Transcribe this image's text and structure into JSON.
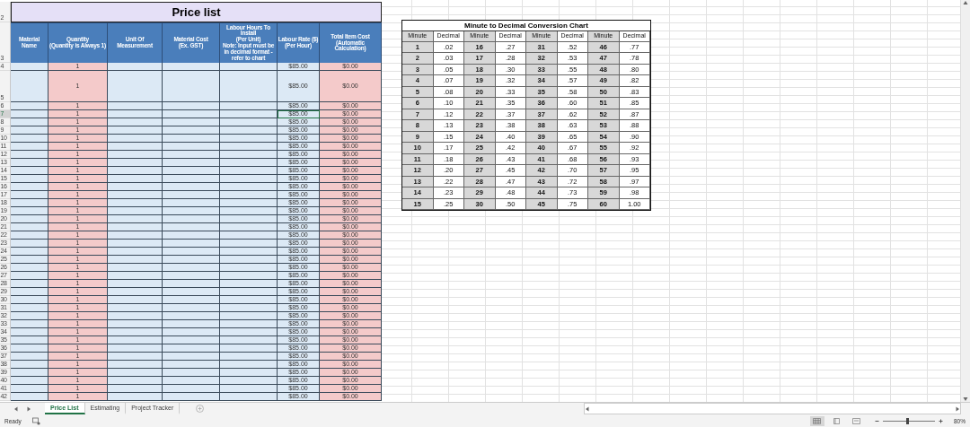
{
  "price_list": {
    "row_number": "2",
    "title": "Price list",
    "header_row_number": "3",
    "columns": [
      {
        "label": "Material Name"
      },
      {
        "label": "Quantity",
        "sub": "(Quantity is Always 1)"
      },
      {
        "label": "Unit Of Measurement"
      },
      {
        "label": "Material Cost",
        "sub": "(Ex. GST)"
      },
      {
        "label": "Labour Hours To Install",
        "sub": "(Per Unit)",
        "note": "Note: Input must be in decimal format - refer to chart"
      },
      {
        "label": "Labour Rate ($)",
        "sub": "(Per Hour)"
      },
      {
        "label": "Total Item Cost",
        "sub": "(Automatic Calculation)"
      }
    ],
    "rows": [
      {
        "number": "4",
        "kind": "normal",
        "quantity": "1",
        "labour_rate": "$85.00",
        "total": "$0.00",
        "selected": false
      },
      {
        "number": "5",
        "kind": "tall",
        "quantity": "1",
        "labour_rate": "$85.00",
        "total": "$0.00",
        "selected": false
      },
      {
        "number": "6",
        "kind": "normal",
        "quantity": "1",
        "labour_rate": "$85.00",
        "total": "$0.00",
        "selected": false
      },
      {
        "number": "7",
        "kind": "normal",
        "quantity": "1",
        "labour_rate": "$85.00",
        "total": "$0.00",
        "selected": true
      },
      {
        "number": "8",
        "kind": "normal",
        "quantity": "1",
        "labour_rate": "$85.00",
        "total": "$0.00",
        "selected": false
      },
      {
        "number": "9",
        "kind": "normal",
        "quantity": "1",
        "labour_rate": "$85.00",
        "total": "$0.00",
        "selected": false
      },
      {
        "number": "10",
        "kind": "normal",
        "quantity": "1",
        "labour_rate": "$85.00",
        "total": "$0.00",
        "selected": false
      },
      {
        "number": "11",
        "kind": "normal",
        "quantity": "1",
        "labour_rate": "$85.00",
        "total": "$0.00",
        "selected": false
      },
      {
        "number": "12",
        "kind": "normal",
        "quantity": "1",
        "labour_rate": "$85.00",
        "total": "$0.00",
        "selected": false
      },
      {
        "number": "13",
        "kind": "normal",
        "quantity": "1",
        "labour_rate": "$85.00",
        "total": "$0.00",
        "selected": false
      },
      {
        "number": "14",
        "kind": "normal",
        "quantity": "1",
        "labour_rate": "$85.00",
        "total": "$0.00",
        "selected": false
      },
      {
        "number": "15",
        "kind": "normal",
        "quantity": "1",
        "labour_rate": "$85.00",
        "total": "$0.00",
        "selected": false
      },
      {
        "number": "16",
        "kind": "normal",
        "quantity": "1",
        "labour_rate": "$85.00",
        "total": "$0.00",
        "selected": false
      },
      {
        "number": "17",
        "kind": "normal",
        "quantity": "1",
        "labour_rate": "$85.00",
        "total": "$0.00",
        "selected": false
      },
      {
        "number": "18",
        "kind": "normal",
        "quantity": "1",
        "labour_rate": "$85.00",
        "total": "$0.00",
        "selected": false
      },
      {
        "number": "19",
        "kind": "normal",
        "quantity": "1",
        "labour_rate": "$85.00",
        "total": "$0.00",
        "selected": false
      },
      {
        "number": "20",
        "kind": "normal",
        "quantity": "1",
        "labour_rate": "$85.00",
        "total": "$0.00",
        "selected": false
      },
      {
        "number": "21",
        "kind": "normal",
        "quantity": "1",
        "labour_rate": "$85.00",
        "total": "$0.00",
        "selected": false
      },
      {
        "number": "22",
        "kind": "normal",
        "quantity": "1",
        "labour_rate": "$85.00",
        "total": "$0.00",
        "selected": false
      },
      {
        "number": "23",
        "kind": "normal",
        "quantity": "1",
        "labour_rate": "$85.00",
        "total": "$0.00",
        "selected": false
      },
      {
        "number": "24",
        "kind": "normal",
        "quantity": "1",
        "labour_rate": "$85.00",
        "total": "$0.00",
        "selected": false
      },
      {
        "number": "25",
        "kind": "normal",
        "quantity": "1",
        "labour_rate": "$85.00",
        "total": "$0.00",
        "selected": false
      },
      {
        "number": "26",
        "kind": "normal",
        "quantity": "1",
        "labour_rate": "$85.00",
        "total": "$0.00",
        "selected": false
      },
      {
        "number": "27",
        "kind": "normal",
        "quantity": "1",
        "labour_rate": "$85.00",
        "total": "$0.00",
        "selected": false
      },
      {
        "number": "28",
        "kind": "normal",
        "quantity": "1",
        "labour_rate": "$85.00",
        "total": "$0.00",
        "selected": false
      },
      {
        "number": "29",
        "kind": "normal",
        "quantity": "1",
        "labour_rate": "$85.00",
        "total": "$0.00",
        "selected": false
      },
      {
        "number": "30",
        "kind": "normal",
        "quantity": "1",
        "labour_rate": "$85.00",
        "total": "$0.00",
        "selected": false
      },
      {
        "number": "31",
        "kind": "normal",
        "quantity": "1",
        "labour_rate": "$85.00",
        "total": "$0.00",
        "selected": false
      },
      {
        "number": "32",
        "kind": "normal",
        "quantity": "1",
        "labour_rate": "$85.00",
        "total": "$0.00",
        "selected": false
      },
      {
        "number": "33",
        "kind": "normal",
        "quantity": "1",
        "labour_rate": "$85.00",
        "total": "$0.00",
        "selected": false
      },
      {
        "number": "34",
        "kind": "normal",
        "quantity": "1",
        "labour_rate": "$85.00",
        "total": "$0.00",
        "selected": false
      },
      {
        "number": "35",
        "kind": "normal",
        "quantity": "1",
        "labour_rate": "$85.00",
        "total": "$0.00",
        "selected": false
      },
      {
        "number": "36",
        "kind": "normal",
        "quantity": "1",
        "labour_rate": "$85.00",
        "total": "$0.00",
        "selected": false
      },
      {
        "number": "37",
        "kind": "normal",
        "quantity": "1",
        "labour_rate": "$85.00",
        "total": "$0.00",
        "selected": false
      },
      {
        "number": "38",
        "kind": "normal",
        "quantity": "1",
        "labour_rate": "$85.00",
        "total": "$0.00",
        "selected": false
      },
      {
        "number": "39",
        "kind": "normal",
        "quantity": "1",
        "labour_rate": "$85.00",
        "total": "$0.00",
        "selected": false
      },
      {
        "number": "40",
        "kind": "normal",
        "quantity": "1",
        "labour_rate": "$85.00",
        "total": "$0.00",
        "selected": false
      },
      {
        "number": "41",
        "kind": "normal",
        "quantity": "1",
        "labour_rate": "$85.00",
        "total": "$0.00",
        "selected": false
      },
      {
        "number": "42",
        "kind": "normal",
        "quantity": "1",
        "labour_rate": "$85.00",
        "total": "$0.00",
        "selected": false
      }
    ]
  },
  "conversion_chart": {
    "title": "Minute to Decimal Conversion Chart",
    "headers": [
      "Minute",
      "Decimal",
      "Minute",
      "Decimal",
      "Minute",
      "Decimal",
      "Minute",
      "Decimal"
    ],
    "rows": [
      [
        "1",
        ".02",
        "16",
        ".27",
        "31",
        ".52",
        "46",
        ".77"
      ],
      [
        "2",
        ".03",
        "17",
        ".28",
        "32",
        ".53",
        "47",
        ".78"
      ],
      [
        "3",
        ".05",
        "18",
        ".30",
        "33",
        ".55",
        "48",
        ".80"
      ],
      [
        "4",
        ".07",
        "19",
        ".32",
        "34",
        ".57",
        "49",
        ".82"
      ],
      [
        "5",
        ".08",
        "20",
        ".33",
        "35",
        ".58",
        "50",
        ".83"
      ],
      [
        "6",
        ".10",
        "21",
        ".35",
        "36",
        ".60",
        "51",
        ".85"
      ],
      [
        "7",
        ".12",
        "22",
        ".37",
        "37",
        ".62",
        "52",
        ".87"
      ],
      [
        "8",
        ".13",
        "23",
        ".38",
        "38",
        ".63",
        "53",
        ".88"
      ],
      [
        "9",
        ".15",
        "24",
        ".40",
        "39",
        ".65",
        "54",
        ".90"
      ],
      [
        "10",
        ".17",
        "25",
        ".42",
        "40",
        ".67",
        "55",
        ".92"
      ],
      [
        "11",
        ".18",
        "26",
        ".43",
        "41",
        ".68",
        "56",
        ".93"
      ],
      [
        "12",
        ".20",
        "27",
        ".45",
        "42",
        ".70",
        "57",
        ".95"
      ],
      [
        "13",
        ".22",
        "28",
        ".47",
        "43",
        ".72",
        "58",
        ".97"
      ],
      [
        "14",
        ".23",
        "29",
        ".48",
        "44",
        ".73",
        "59",
        ".98"
      ],
      [
        "15",
        ".25",
        "30",
        ".50",
        "45",
        ".75",
        "60",
        "1.00"
      ]
    ]
  },
  "sheet_tabs": [
    {
      "label": "Price List",
      "selected": true
    },
    {
      "label": "Estimating",
      "selected": false
    },
    {
      "label": "Project Tracker",
      "selected": false
    }
  ],
  "status_bar": {
    "status": "Ready",
    "views": [
      {
        "kind": "normal",
        "selected": true
      },
      {
        "kind": "layout",
        "selected": false
      },
      {
        "kind": "break",
        "selected": false
      }
    ],
    "zoom_slider": {
      "level": 0.45
    },
    "zoom": "80%"
  }
}
